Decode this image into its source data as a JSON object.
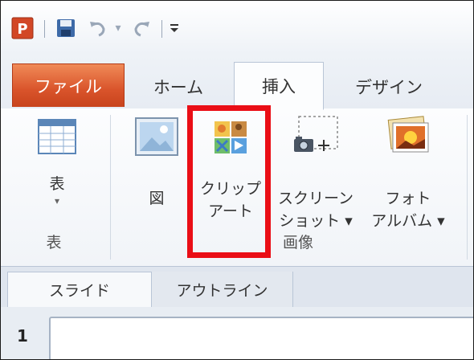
{
  "quick_access": {
    "app_icon_letter": "P",
    "icons": [
      "powerpoint-logo-icon",
      "save-icon",
      "undo-icon",
      "redo-icon",
      "customize-qat-icon"
    ]
  },
  "tabs": {
    "file": "ファイル",
    "home": "ホーム",
    "insert": "挿入",
    "design": "デザイン"
  },
  "ribbon": {
    "tables_group": {
      "table_button": "表",
      "group_label": "表"
    },
    "images_group": {
      "picture_button": "図",
      "clipart_line1": "クリップ",
      "clipart_line2": "アート",
      "screenshot_line1": "スクリーン",
      "screenshot_line2": "ショット ▾",
      "photo_album_line1": "フォト",
      "photo_album_line2": "アルバム ▾",
      "group_label": "画像"
    }
  },
  "panel": {
    "slides_tab": "スライド",
    "outline_tab": "アウトライン",
    "slide_number": "1"
  },
  "colors": {
    "file_tab": "#d9542b",
    "highlight": "#ea0e16"
  }
}
